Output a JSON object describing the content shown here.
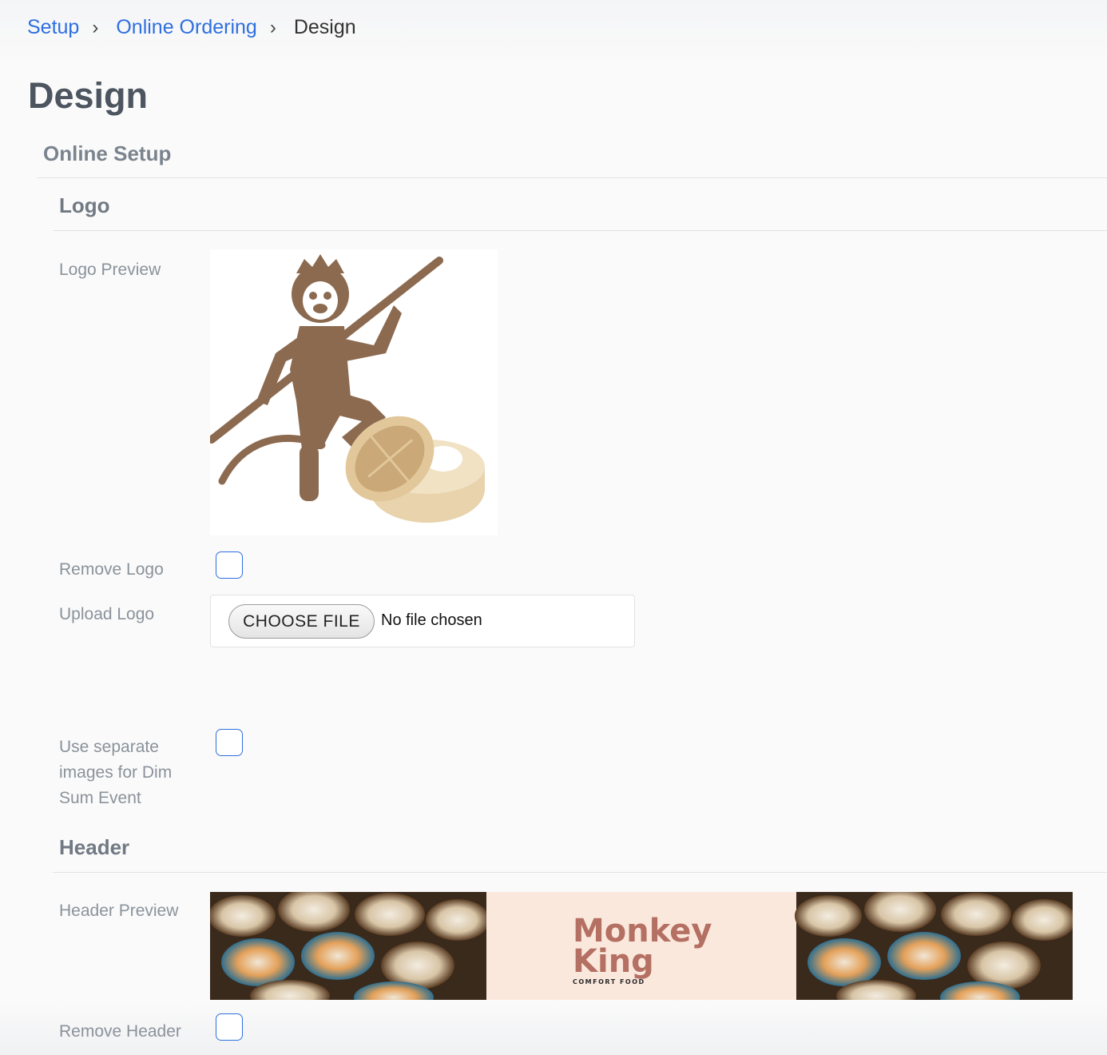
{
  "breadcrumb": {
    "items": [
      "Setup",
      "Online Ordering"
    ],
    "current": "Design",
    "separator": "›"
  },
  "page": {
    "title": "Design"
  },
  "online_setup": {
    "title": "Online Setup",
    "logo_section": {
      "title": "Logo",
      "preview_label": "Logo Preview",
      "remove_label": "Remove Logo",
      "upload_label": "Upload Logo",
      "file_button": "CHOOSE FILE",
      "file_status": "No file chosen",
      "separate_images_label": "Use separate images for Dim Sum Event"
    },
    "header_section": {
      "title": "Header",
      "preview_label": "Header Preview",
      "remove_label": "Remove Header",
      "brand_name_line1": "Monkey",
      "brand_name_line2": "King",
      "brand_tagline": "COMFORT FOOD"
    }
  },
  "colors": {
    "link": "#2f6fe0",
    "logo_brown": "#8c6a50",
    "brand_text": "#b47062",
    "header_center_bg": "#fbe8dd",
    "checkbox_border": "#2f6fe0"
  },
  "icons": {
    "separator": "chevron-right-icon"
  }
}
